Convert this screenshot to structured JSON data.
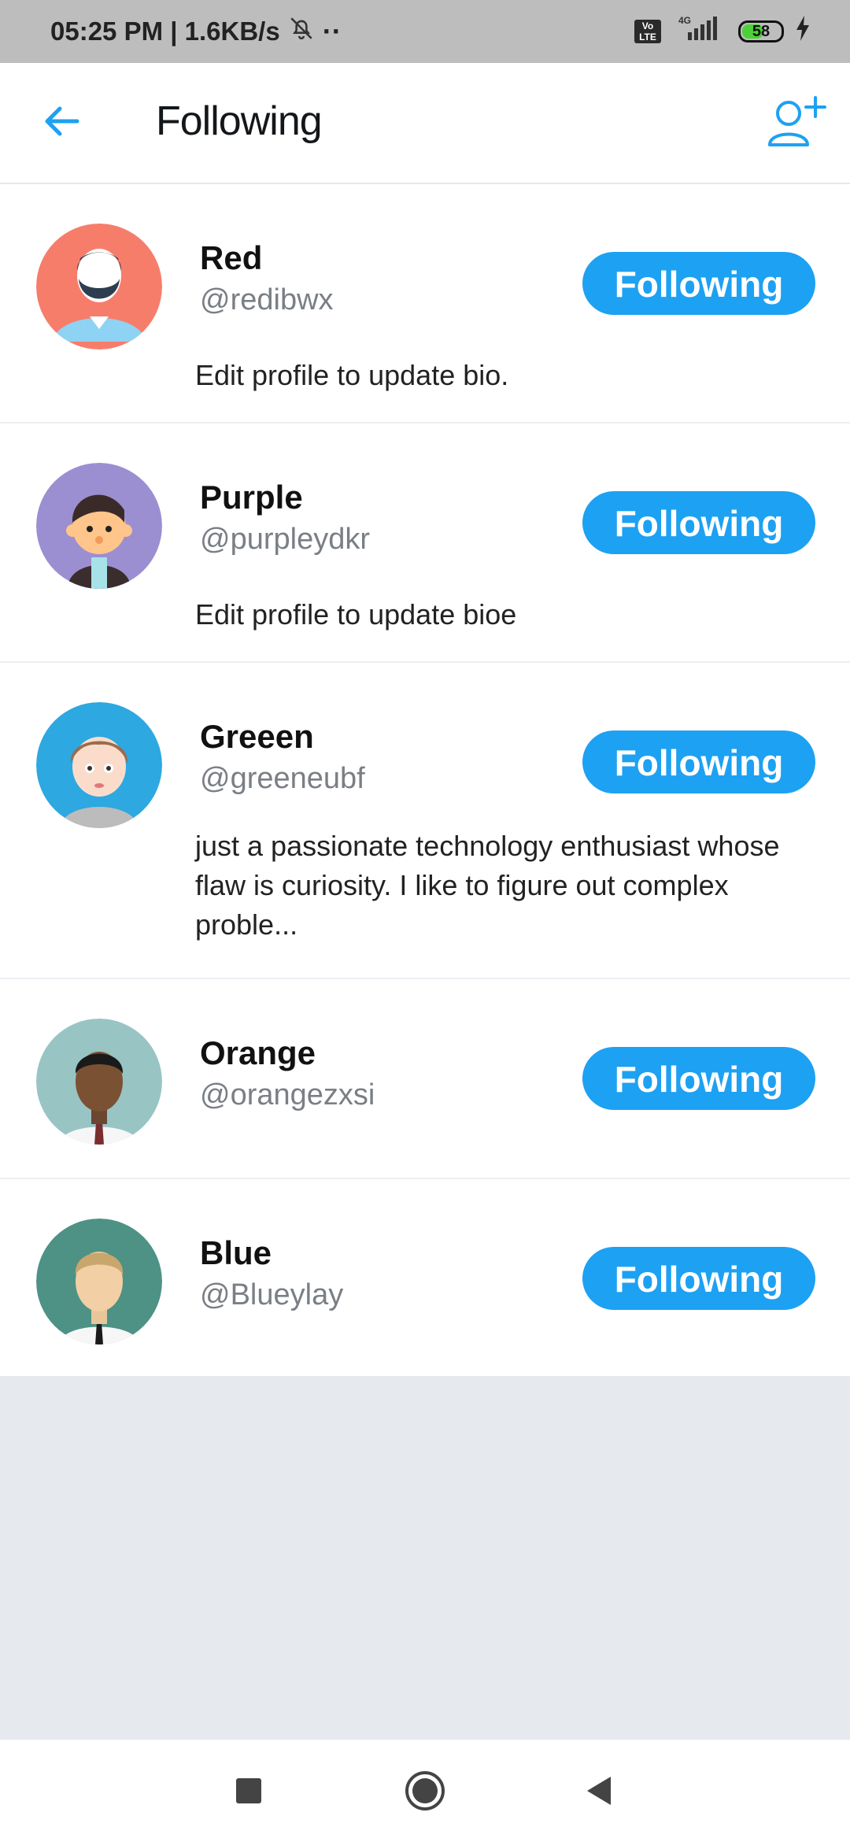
{
  "status_bar": {
    "time_speed": "05:25 PM | 1.6KB/s",
    "network": "4G",
    "volte": "Vo LTE",
    "battery": "58",
    "battery_level": 0.58
  },
  "header": {
    "title": "Following"
  },
  "icons": {
    "back": "arrow-left-icon",
    "add_user": "add-user-icon",
    "bell_off": "bell-off-icon",
    "nav_recents": "square-icon",
    "nav_home": "circle-icon",
    "nav_back": "triangle-back-icon"
  },
  "colors": {
    "accent": "#1da1f2",
    "empty_area": "#e6eaee"
  },
  "users": [
    {
      "name": "Red",
      "handle": "@redibwx",
      "bio": "Edit profile to update bio.",
      "button": "Following",
      "avatar_color": "#f77d6b"
    },
    {
      "name": "Purple",
      "handle": "@purpleydkr",
      "bio": "Edit profile to update bioe",
      "button": "Following",
      "avatar_color": "#9b8fd1"
    },
    {
      "name": "Greeen",
      "handle": "@greeneubf",
      "bio": "just a passionate technology enthusiast whose flaw is curiosity. I like to figure out complex proble...",
      "button": "Following",
      "avatar_color": "#2da8e0"
    },
    {
      "name": "Orange",
      "handle": "@orangezxsi",
      "bio": "",
      "button": "Following",
      "avatar_color": "#98c4c4"
    },
    {
      "name": "Blue",
      "handle": "@Blueylay",
      "bio": "",
      "button": "Following",
      "avatar_color": "#4e9285"
    }
  ]
}
